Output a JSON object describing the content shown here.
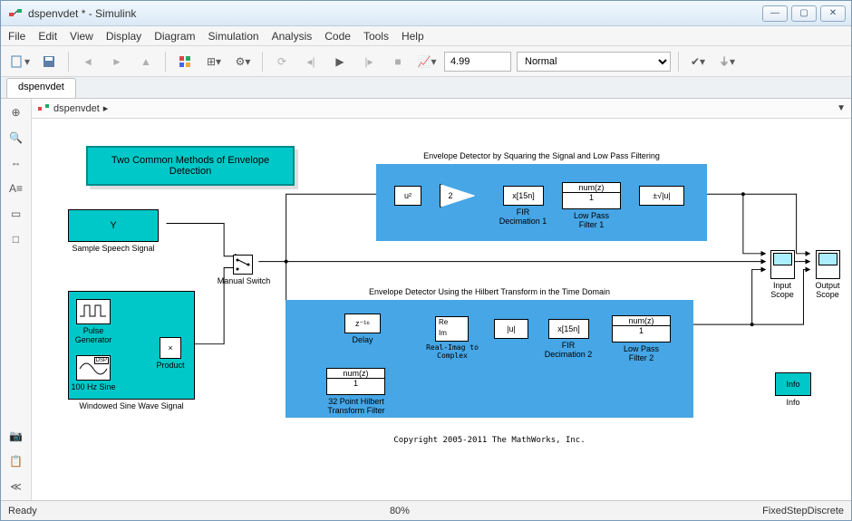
{
  "window": {
    "title": "dspenvdet * - Simulink"
  },
  "menu": [
    "File",
    "Edit",
    "View",
    "Display",
    "Diagram",
    "Simulation",
    "Analysis",
    "Code",
    "Tools",
    "Help"
  ],
  "toolbar": {
    "stopTime": "4.99",
    "mode": "Normal"
  },
  "tabs": [
    "dspenvdet"
  ],
  "crumb": {
    "model": "dspenvdet"
  },
  "status": {
    "left": "Ready",
    "mid": "80%",
    "right": "FixedStepDiscrete"
  },
  "canvas": {
    "title": "Two Common Methods of Envelope Detection",
    "source1": {
      "label": "Y",
      "caption": "Sample Speech Signal"
    },
    "source2": {
      "pulse": "Pulse\nGenerator",
      "sine": "100 Hz Sine",
      "dsp": "DSP",
      "product": "Product",
      "caption": "Windowed Sine Wave Signal"
    },
    "switch": "Manual Switch",
    "sub1": {
      "title": "Envelope Detector by Squaring the Signal and Low Pass Filtering",
      "sq": "u²",
      "gain": "2",
      "dec": "x[15n]",
      "decLabel": "FIR\nDecimation 1",
      "lpf": "num(z)",
      "lpfDen": "1",
      "lpfLabel": "Low Pass\nFilter 1",
      "sqrt": "±√|u|"
    },
    "sub2": {
      "title": "Envelope Detector Using the Hilbert Transform in the Time Domain",
      "delay": "z⁻¹⁶",
      "delayLabel": "Delay",
      "hilbert": "num(z)",
      "hilbertDen": "1",
      "hilbertLabel": "32 Point Hilbert\nTransform Filter",
      "r2c": "Re\nIm",
      "r2cLabel": "Real-Imag to\nComplex",
      "abs": "|u|",
      "dec": "x[15n]",
      "decLabel": "FIR\nDecimation 2",
      "lpf": "num(z)",
      "lpfDen": "1",
      "lpfLabel": "Low Pass\nFilter 2"
    },
    "scopes": {
      "in": "Input\nScope",
      "out": "Output\nScope"
    },
    "info": "Info",
    "copyright": "Copyright 2005-2011 The MathWorks, Inc."
  }
}
